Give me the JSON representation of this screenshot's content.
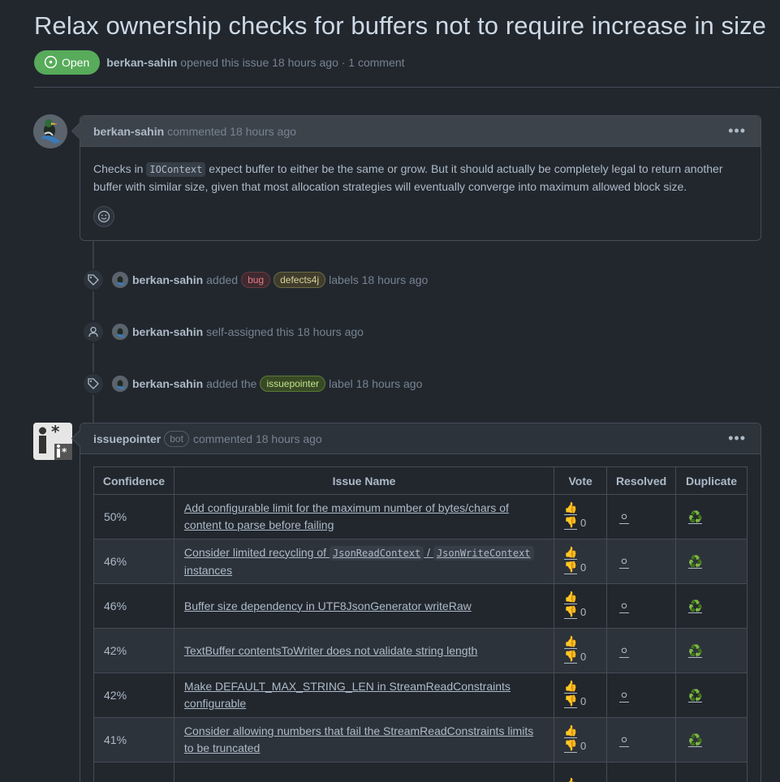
{
  "issue": {
    "title": "Relax ownership checks for buffers not to require increase in size",
    "state": "Open",
    "author": "berkan-sahin",
    "meta_suffix": "opened this issue 18 hours ago · 1 comment"
  },
  "comment1": {
    "author": "berkan-sahin",
    "action": "commented 18 hours ago",
    "body_pre": "Checks in ",
    "body_code": "IOContext",
    "body_post": " expect buffer to either be the same or grow. But it should actually be completely legal to return another buffer with similar size, given that most allocation strategies will eventually converge into maximum allowed block size."
  },
  "events": [
    {
      "author": "berkan-sahin",
      "pre": "added",
      "labels": [
        "bug",
        "defects4j"
      ],
      "post": "labels 18 hours ago"
    },
    {
      "author": "berkan-sahin",
      "pre": "self-assigned this 18 hours ago",
      "labels": [],
      "post": ""
    },
    {
      "author": "berkan-sahin",
      "pre": "added the",
      "labels": [
        "issuepointer"
      ],
      "post": "label 18 hours ago"
    }
  ],
  "comment2": {
    "author": "issuepointer",
    "badge": "bot",
    "action": "commented 18 hours ago",
    "table": {
      "headers": [
        "Confidence",
        "Issue Name",
        "Vote",
        "Resolved",
        "Duplicate"
      ],
      "rows": [
        {
          "confidence": "50%",
          "name": "Add configurable limit for the maximum number of bytes/chars of content to parse before failing",
          "down": "0"
        },
        {
          "confidence": "46%",
          "name_pre": "Consider limited recycling of ",
          "code1": "JsonReadContext",
          "sep": " / ",
          "code2": "JsonWriteContext",
          "name_post": " instances",
          "down": "0"
        },
        {
          "confidence": "46%",
          "name": "Buffer size dependency in UTF8JsonGenerator writeRaw",
          "down": "0"
        },
        {
          "confidence": "42%",
          "name": "TextBuffer contentsToWriter does not validate string length",
          "down": "0"
        },
        {
          "confidence": "42%",
          "name": "Make DEFAULT_MAX_STRING_LEN in StreamReadConstraints configurable",
          "down": "0"
        },
        {
          "confidence": "41%",
          "name": "Consider allowing numbers that fail the StreamReadConstraints limits to be truncated",
          "down": "0"
        }
      ]
    }
  },
  "icons": {
    "up": "👍",
    "down": "👎",
    "resolved": "⚪",
    "duplicate": "♻️"
  }
}
